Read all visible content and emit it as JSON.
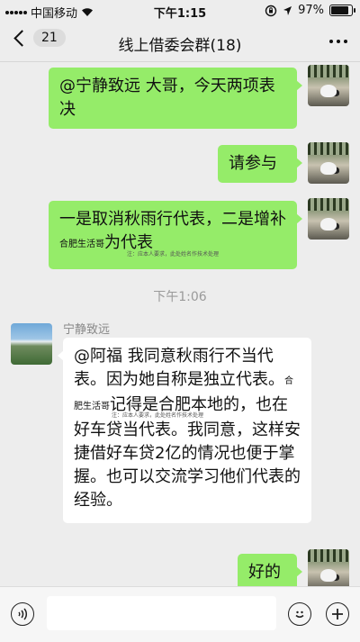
{
  "status_bar": {
    "carrier": "中国移动",
    "time": "下午1:15",
    "battery_text": "97%",
    "battery_level": 0.97
  },
  "nav": {
    "back_count": "21",
    "title": "线上借委会群(18)"
  },
  "messages": [
    {
      "direction": "out",
      "text": "@宁静致远 大哥，今天两项表决"
    },
    {
      "direction": "out",
      "text": "请参与"
    },
    {
      "direction": "out",
      "text_before": "一是取消秋雨行代表，二是增补",
      "mosaic": "合肥生活哥",
      "text_after": "为代表",
      "watermark": "注：应本人要求，此处姓名作技术处理"
    },
    {
      "type": "time",
      "text": "下午1:06"
    },
    {
      "direction": "in",
      "sender": "宁静致远",
      "text_before": "@阿福 我同意秋雨行不当代表。因为她自称是独立代表。",
      "mosaic": "合肥生活哥",
      "text_after": "记得是合肥本地的，也在好车贷当代表。我同意，这样安捷借好车贷2亿的情况也便于掌握。也可以交流学习他们代表的经验。",
      "watermark": "注：应本人要求，此处姓名作技术处理"
    },
    {
      "direction": "out",
      "text": "好的"
    }
  ],
  "icons": [
    "signal-icon",
    "wifi-icon",
    "lock-rotation-icon",
    "location-icon",
    "battery-icon",
    "back-chevron-icon",
    "more-icon",
    "voice-icon",
    "emoji-icon",
    "plus-icon"
  ]
}
